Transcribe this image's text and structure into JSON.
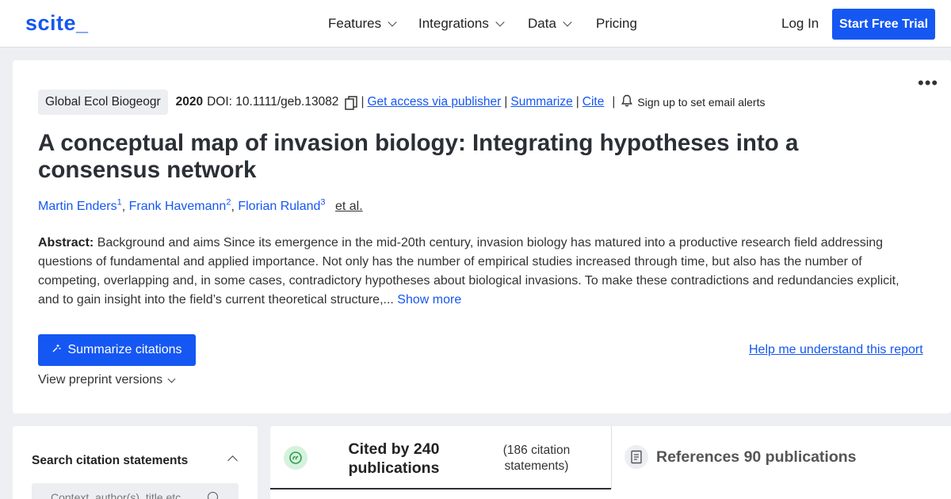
{
  "header": {
    "logo": "scite_",
    "nav": [
      {
        "label": "Features"
      },
      {
        "label": "Integrations"
      },
      {
        "label": "Data"
      },
      {
        "label": "Pricing"
      }
    ],
    "login": "Log In",
    "trial": "Start Free Trial"
  },
  "paper": {
    "journal": "Global Ecol Biogeogr",
    "year": "2020",
    "doi": "DOI: 10.1111/geb.13082",
    "access_link": "Get access via publisher",
    "summarize_link": "Summarize",
    "cite_link": "Cite",
    "alerts": "Sign up to set email alerts",
    "title": "A conceptual map of invasion biology: Integrating hypotheses into a consensus network",
    "authors": [
      {
        "name": "Martin Enders",
        "sup": "1"
      },
      {
        "name": "Frank Havemann",
        "sup": "2"
      },
      {
        "name": "Florian Ruland",
        "sup": "3"
      }
    ],
    "etal": "et al.",
    "abstract_label": "Abstract:",
    "abstract": "Background and aims Since its emergence in the mid-20th century, invasion biology has matured into a productive research field addressing questions of fundamental and applied importance. Not only has the number of empirical studies increased through time, but also has the number of competing, overlapping and, in some cases, contradictory hypotheses about biological invasions. To make these contradictions and redundancies explicit, and to gain insight into the field’s current theoretical structure,...",
    "show_more": "Show more",
    "summarize_citations": "Summarize citations",
    "help_link": "Help me understand this report",
    "preprint": "View preprint versions"
  },
  "sidebar": {
    "title": "Search citation statements",
    "search_placeholder": "Context, author(s), title etc."
  },
  "tabs": {
    "cited_by": "Cited by 240 publications",
    "citation_statements": "(186 citation statements)",
    "references": "References 90 publications"
  },
  "colors": {
    "brand": "#1557f2",
    "cited_icon_bg": "#d5f2dd",
    "cited_icon": "#2e9e4f"
  },
  "icons": {
    "copy": "copy-icon",
    "bell": "bell-icon",
    "sparkle": "sparkle-icon",
    "quote": "quote-bubble-icon",
    "references": "document-icon",
    "search": "search-icon",
    "more": "more-dots-icon"
  }
}
